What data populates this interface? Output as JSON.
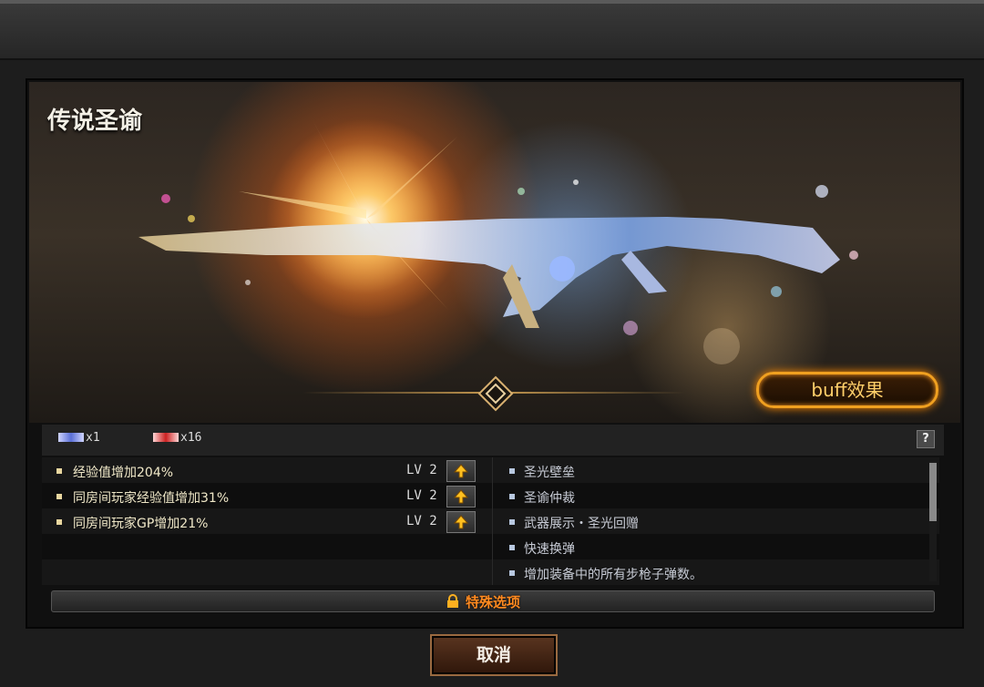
{
  "dialog": {
    "title": "传说圣谕",
    "buff_label": "buff效果"
  },
  "stats_bar": {
    "items": [
      {
        "icon": "silver-ticket-icon",
        "count": "x1"
      },
      {
        "icon": "red-ticket-icon",
        "count": "x16"
      }
    ],
    "help_label": "?"
  },
  "bonuses": [
    {
      "text": "经验值增加204%",
      "level": "LV 2"
    },
    {
      "text": "同房间玩家经验值增加31%",
      "level": "LV 2"
    },
    {
      "text": "同房间玩家GP增加21%",
      "level": "LV 2"
    }
  ],
  "features": [
    "圣光壁垒",
    "圣谕仲裁",
    "武器展示・圣光回赠",
    "快速换弹",
    "增加装备中的所有步枪子弹数。"
  ],
  "special_option_label": "特殊选项",
  "cancel_label": "取消",
  "colors": {
    "accent_orange": "#ff8a20",
    "buff_border": "#f0a020",
    "panel_bg": "#101010"
  }
}
